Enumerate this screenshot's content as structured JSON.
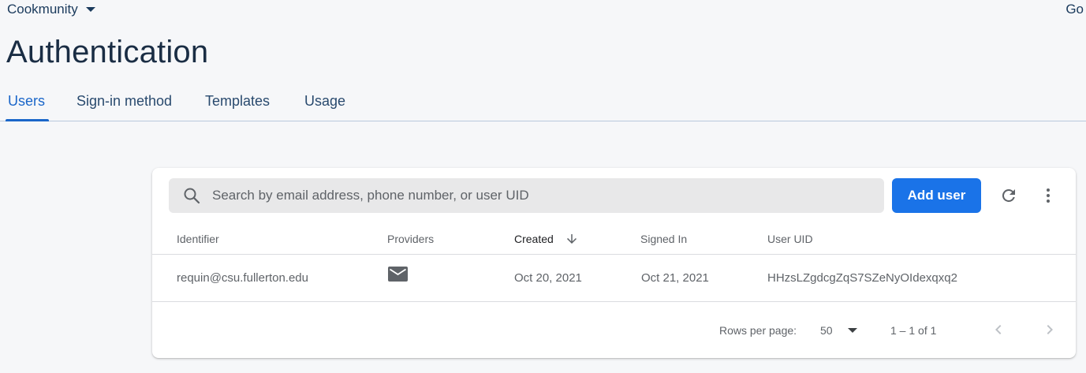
{
  "topbar": {
    "project_name": "Cookmunity",
    "right_link": "Go"
  },
  "page": {
    "title": "Authentication"
  },
  "tabs": [
    {
      "label": "Users",
      "active": true
    },
    {
      "label": "Sign-in method",
      "active": false
    },
    {
      "label": "Templates",
      "active": false
    },
    {
      "label": "Usage",
      "active": false
    }
  ],
  "toolbar": {
    "search_placeholder": "Search by email address, phone number, or user UID",
    "add_user_label": "Add user",
    "refresh_icon": "refresh-icon",
    "more_icon": "more-vert-icon"
  },
  "table": {
    "columns": [
      "Identifier",
      "Providers",
      "Created",
      "Signed In",
      "User UID"
    ],
    "sorted_column": "Created",
    "sort_direction": "descending",
    "rows": [
      {
        "identifier": "requin@csu.fullerton.edu",
        "provider_icon": "email-icon",
        "created": "Oct 20, 2021",
        "signed_in": "Oct 21, 2021",
        "uid": "HHzsLZgdcgZqS7SZeNyOIdexqxq2"
      }
    ]
  },
  "pagination": {
    "rows_per_page_label": "Rows per page:",
    "rows_per_page_value": "50",
    "range_label": "1 – 1 of 1"
  },
  "colors": {
    "accent": "#1a73e8",
    "title": "#1a2d44",
    "page_background": "#f6f7f9"
  }
}
